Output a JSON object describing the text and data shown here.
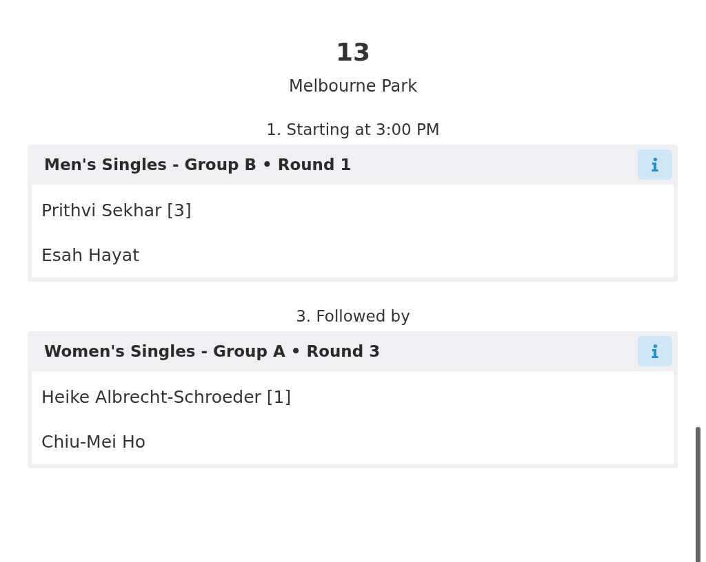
{
  "court": {
    "number": "13",
    "venue": "Melbourne Park"
  },
  "matches": [
    {
      "label": "1. Starting at 3:00 PM",
      "title": "Men's Singles - Group B • Round 1",
      "players": [
        "Prithvi Sekhar [3]",
        "Esah Hayat"
      ]
    },
    {
      "label": "3. Followed by",
      "title": "Women's Singles - Group A • Round 3",
      "players": [
        "Heike Albrecht-Schroeder [1]",
        "Chiu-Mei Ho"
      ]
    }
  ]
}
